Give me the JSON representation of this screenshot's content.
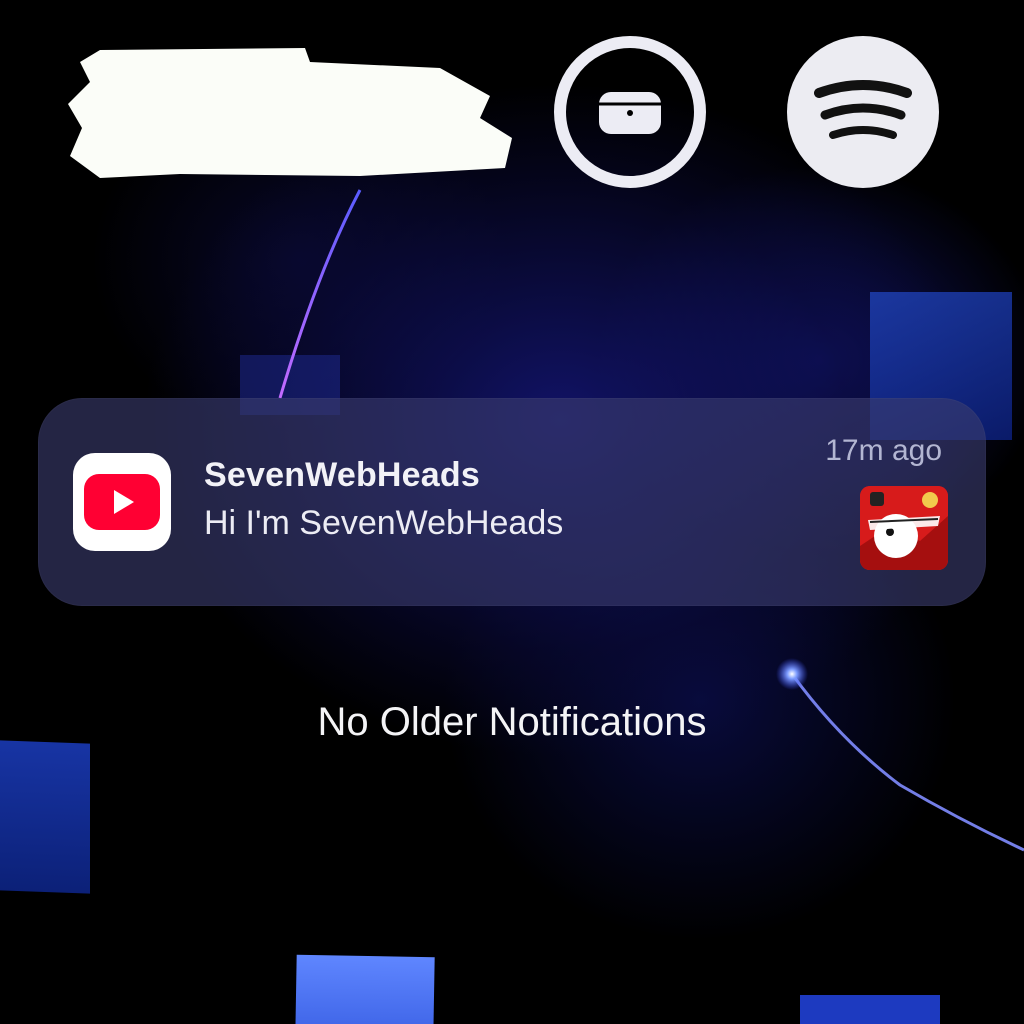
{
  "controls": {
    "airpods_icon": "airpods-case-icon",
    "spotify_icon": "spotify-icon"
  },
  "notification": {
    "app_icon": "youtube-icon",
    "title": "SevenWebHeads",
    "body": "Hi I'm SevenWebHeads",
    "time": "17m ago",
    "thumbnail": "channel-avatar-thumbnail"
  },
  "footer": {
    "empty_text": "No Older Notifications"
  },
  "colors": {
    "youtube_red": "#ff0033",
    "card_bg": "#3a3c6e",
    "control_fill": "#ececf2"
  }
}
